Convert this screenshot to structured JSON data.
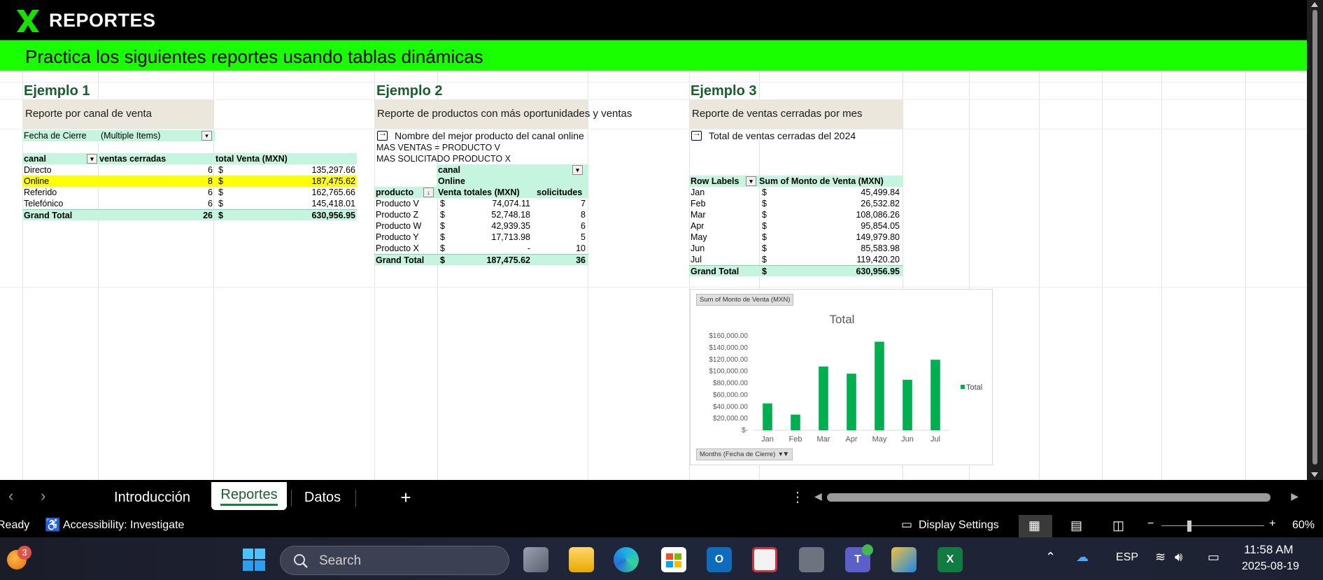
{
  "header": {
    "title": "REPORTES",
    "subtitle": "Practica los siguientes reportes usando tablas dinámicas"
  },
  "ejemplo1": {
    "title": "Ejemplo 1",
    "desc": "Reporte por canal de venta",
    "filter_label": "Fecha de Cierre",
    "filter_value": "(Multiple Items)",
    "headers": [
      "canal",
      "ventas cerradas",
      "total Venta (MXN)"
    ],
    "rows": [
      {
        "canal": "Directo",
        "ventas": "6",
        "cur": "$",
        "total": "135,297.66"
      },
      {
        "canal": "Online",
        "ventas": "8",
        "cur": "$",
        "total": "187,475.62"
      },
      {
        "canal": "Referido",
        "ventas": "6",
        "cur": "$",
        "total": "162,765.66"
      },
      {
        "canal": "Telefónico",
        "ventas": "6",
        "cur": "$",
        "total": "145,418.01"
      }
    ],
    "grand_total": {
      "label": "Grand Total",
      "ventas": "26",
      "cur": "$",
      "total": "630,956.95"
    }
  },
  "ejemplo2": {
    "title": "Ejemplo 2",
    "desc": "Reporte de productos con más oportunidades y ventas",
    "note": "Nombre del mejor producto del canal online",
    "line1": "MAS VENTAS = PRODUCTO V",
    "line2": "MAS SOLICITADO PRODUCTO X",
    "col_field": "canal",
    "col_value": "Online",
    "headers": [
      "producto",
      "Venta totales (MXN)",
      "solicitudes"
    ],
    "rows": [
      {
        "producto": "Producto V",
        "cur": "$",
        "venta": "74,074.11",
        "sol": "7"
      },
      {
        "producto": "Producto Z",
        "cur": "$",
        "venta": "52,748.18",
        "sol": "8"
      },
      {
        "producto": "Producto W",
        "cur": "$",
        "venta": "42,939.35",
        "sol": "6"
      },
      {
        "producto": "Producto Y",
        "cur": "$",
        "venta": "17,713.98",
        "sol": "5"
      },
      {
        "producto": "Producto X",
        "cur": "$",
        "venta": "-",
        "sol": "10"
      }
    ],
    "grand_total": {
      "label": "Grand Total",
      "cur": "$",
      "venta": "187,475.62",
      "sol": "36"
    }
  },
  "ejemplo3": {
    "title": "Ejemplo 3",
    "desc": "Reporte de ventas cerradas por mes",
    "note": "Total de ventas cerradas del 2024",
    "headers": [
      "Row Labels",
      "Sum of Monto de Venta (MXN)"
    ],
    "rows": [
      {
        "mes": "Jan",
        "cur": "$",
        "monto": "45,499.84"
      },
      {
        "mes": "Feb",
        "cur": "$",
        "monto": "26,532.82"
      },
      {
        "mes": "Mar",
        "cur": "$",
        "monto": "108,086.26"
      },
      {
        "mes": "Apr",
        "cur": "$",
        "monto": "95,854.05"
      },
      {
        "mes": "May",
        "cur": "$",
        "monto": "149,979.80"
      },
      {
        "mes": "Jun",
        "cur": "$",
        "monto": "85,583.98"
      },
      {
        "mes": "Jul",
        "cur": "$",
        "monto": "119,420.20"
      }
    ],
    "grand_total": {
      "label": "Grand Total",
      "cur": "$",
      "monto": "630,956.95"
    }
  },
  "chart_data": {
    "type": "bar",
    "title": "Total",
    "value_field_button": "Sum of Monto de Venta (MXN)",
    "axis_field_button": "Months (Fecha de Cierre)",
    "categories": [
      "Jan",
      "Feb",
      "Mar",
      "Apr",
      "May",
      "Jun",
      "Jul"
    ],
    "series": [
      {
        "name": "Total",
        "values": [
          45499.84,
          26532.82,
          108086.26,
          95854.05,
          149979.8,
          85583.98,
          119420.2
        ]
      }
    ],
    "ylim": [
      0,
      160000
    ],
    "yticks": [
      "$-",
      "$20,000.00",
      "$40,000.00",
      "$60,000.00",
      "$80,000.00",
      "$100,000.00",
      "$120,000.00",
      "$140,000.00",
      "$160,000.00"
    ],
    "legend": "right",
    "color": "#00b050"
  },
  "tabs": {
    "items": [
      "Introducción",
      "Reportes",
      "Datos"
    ],
    "active": "Reportes",
    "add": "+"
  },
  "status": {
    "ready": "Ready",
    "accessibility": "Accessibility: Investigate",
    "display_settings": "Display Settings",
    "zoom": "60%"
  },
  "taskbar": {
    "search_placeholder": "Search",
    "notification_count": "3",
    "language": "ESP",
    "time": "11:58 AM",
    "date": "2025-08-19"
  }
}
